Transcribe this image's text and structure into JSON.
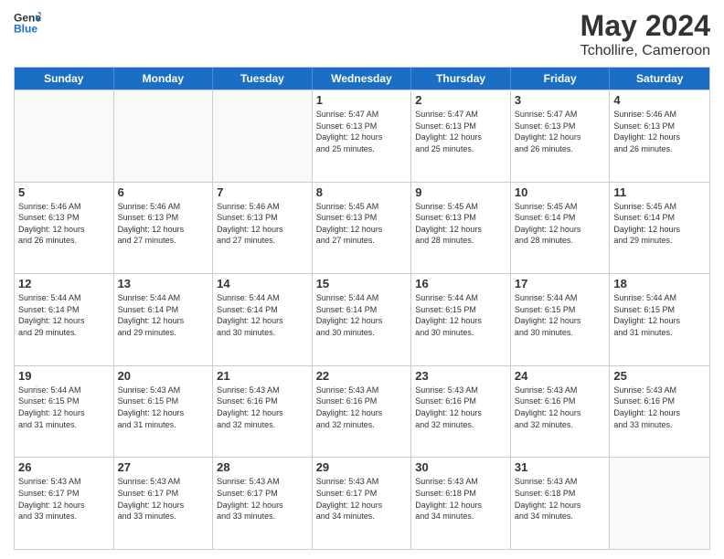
{
  "header": {
    "logo_line1": "General",
    "logo_line2": "Blue",
    "title": "May 2024",
    "subtitle": "Tchollire, Cameroon"
  },
  "weekdays": [
    "Sunday",
    "Monday",
    "Tuesday",
    "Wednesday",
    "Thursday",
    "Friday",
    "Saturday"
  ],
  "weeks": [
    [
      {
        "day": "",
        "info": "",
        "empty": true
      },
      {
        "day": "",
        "info": "",
        "empty": true
      },
      {
        "day": "",
        "info": "",
        "empty": true
      },
      {
        "day": "1",
        "info": "Sunrise: 5:47 AM\nSunset: 6:13 PM\nDaylight: 12 hours\nand 25 minutes.",
        "empty": false
      },
      {
        "day": "2",
        "info": "Sunrise: 5:47 AM\nSunset: 6:13 PM\nDaylight: 12 hours\nand 25 minutes.",
        "empty": false
      },
      {
        "day": "3",
        "info": "Sunrise: 5:47 AM\nSunset: 6:13 PM\nDaylight: 12 hours\nand 26 minutes.",
        "empty": false
      },
      {
        "day": "4",
        "info": "Sunrise: 5:46 AM\nSunset: 6:13 PM\nDaylight: 12 hours\nand 26 minutes.",
        "empty": false
      }
    ],
    [
      {
        "day": "5",
        "info": "Sunrise: 5:46 AM\nSunset: 6:13 PM\nDaylight: 12 hours\nand 26 minutes.",
        "empty": false
      },
      {
        "day": "6",
        "info": "Sunrise: 5:46 AM\nSunset: 6:13 PM\nDaylight: 12 hours\nand 27 minutes.",
        "empty": false
      },
      {
        "day": "7",
        "info": "Sunrise: 5:46 AM\nSunset: 6:13 PM\nDaylight: 12 hours\nand 27 minutes.",
        "empty": false
      },
      {
        "day": "8",
        "info": "Sunrise: 5:45 AM\nSunset: 6:13 PM\nDaylight: 12 hours\nand 27 minutes.",
        "empty": false
      },
      {
        "day": "9",
        "info": "Sunrise: 5:45 AM\nSunset: 6:13 PM\nDaylight: 12 hours\nand 28 minutes.",
        "empty": false
      },
      {
        "day": "10",
        "info": "Sunrise: 5:45 AM\nSunset: 6:14 PM\nDaylight: 12 hours\nand 28 minutes.",
        "empty": false
      },
      {
        "day": "11",
        "info": "Sunrise: 5:45 AM\nSunset: 6:14 PM\nDaylight: 12 hours\nand 29 minutes.",
        "empty": false
      }
    ],
    [
      {
        "day": "12",
        "info": "Sunrise: 5:44 AM\nSunset: 6:14 PM\nDaylight: 12 hours\nand 29 minutes.",
        "empty": false
      },
      {
        "day": "13",
        "info": "Sunrise: 5:44 AM\nSunset: 6:14 PM\nDaylight: 12 hours\nand 29 minutes.",
        "empty": false
      },
      {
        "day": "14",
        "info": "Sunrise: 5:44 AM\nSunset: 6:14 PM\nDaylight: 12 hours\nand 30 minutes.",
        "empty": false
      },
      {
        "day": "15",
        "info": "Sunrise: 5:44 AM\nSunset: 6:14 PM\nDaylight: 12 hours\nand 30 minutes.",
        "empty": false
      },
      {
        "day": "16",
        "info": "Sunrise: 5:44 AM\nSunset: 6:15 PM\nDaylight: 12 hours\nand 30 minutes.",
        "empty": false
      },
      {
        "day": "17",
        "info": "Sunrise: 5:44 AM\nSunset: 6:15 PM\nDaylight: 12 hours\nand 30 minutes.",
        "empty": false
      },
      {
        "day": "18",
        "info": "Sunrise: 5:44 AM\nSunset: 6:15 PM\nDaylight: 12 hours\nand 31 minutes.",
        "empty": false
      }
    ],
    [
      {
        "day": "19",
        "info": "Sunrise: 5:44 AM\nSunset: 6:15 PM\nDaylight: 12 hours\nand 31 minutes.",
        "empty": false
      },
      {
        "day": "20",
        "info": "Sunrise: 5:43 AM\nSunset: 6:15 PM\nDaylight: 12 hours\nand 31 minutes.",
        "empty": false
      },
      {
        "day": "21",
        "info": "Sunrise: 5:43 AM\nSunset: 6:16 PM\nDaylight: 12 hours\nand 32 minutes.",
        "empty": false
      },
      {
        "day": "22",
        "info": "Sunrise: 5:43 AM\nSunset: 6:16 PM\nDaylight: 12 hours\nand 32 minutes.",
        "empty": false
      },
      {
        "day": "23",
        "info": "Sunrise: 5:43 AM\nSunset: 6:16 PM\nDaylight: 12 hours\nand 32 minutes.",
        "empty": false
      },
      {
        "day": "24",
        "info": "Sunrise: 5:43 AM\nSunset: 6:16 PM\nDaylight: 12 hours\nand 32 minutes.",
        "empty": false
      },
      {
        "day": "25",
        "info": "Sunrise: 5:43 AM\nSunset: 6:16 PM\nDaylight: 12 hours\nand 33 minutes.",
        "empty": false
      }
    ],
    [
      {
        "day": "26",
        "info": "Sunrise: 5:43 AM\nSunset: 6:17 PM\nDaylight: 12 hours\nand 33 minutes.",
        "empty": false
      },
      {
        "day": "27",
        "info": "Sunrise: 5:43 AM\nSunset: 6:17 PM\nDaylight: 12 hours\nand 33 minutes.",
        "empty": false
      },
      {
        "day": "28",
        "info": "Sunrise: 5:43 AM\nSunset: 6:17 PM\nDaylight: 12 hours\nand 33 minutes.",
        "empty": false
      },
      {
        "day": "29",
        "info": "Sunrise: 5:43 AM\nSunset: 6:17 PM\nDaylight: 12 hours\nand 34 minutes.",
        "empty": false
      },
      {
        "day": "30",
        "info": "Sunrise: 5:43 AM\nSunset: 6:18 PM\nDaylight: 12 hours\nand 34 minutes.",
        "empty": false
      },
      {
        "day": "31",
        "info": "Sunrise: 5:43 AM\nSunset: 6:18 PM\nDaylight: 12 hours\nand 34 minutes.",
        "empty": false
      },
      {
        "day": "",
        "info": "",
        "empty": true
      }
    ]
  ],
  "colors": {
    "header_bg": "#1a6fc4",
    "header_text": "#ffffff",
    "border": "#cccccc",
    "empty_bg": "#f0f0f0"
  }
}
